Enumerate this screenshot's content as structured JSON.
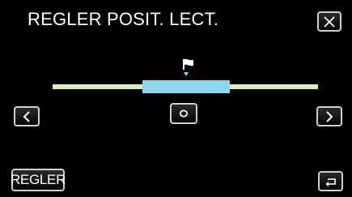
{
  "header": {
    "title": "REGLER POSIT. LECT."
  },
  "buttons": {
    "set_label": "REGLER"
  },
  "icons": {
    "close": "close-icon",
    "prev": "chevron-left-icon",
    "next": "chevron-right-icon",
    "center": "circle-icon",
    "back": "return-icon",
    "marker": "flag-icon"
  },
  "colors": {
    "track": "#d9efc6",
    "range": "#8ed5ee",
    "background": "#000000"
  }
}
